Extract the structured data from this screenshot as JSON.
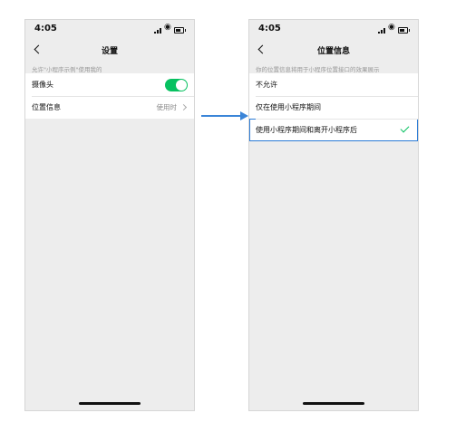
{
  "left_screen": {
    "time": "4:05",
    "title": "设置",
    "section_header": "允许\"小程序示例\"使用我的",
    "camera_label": "摄像头",
    "location_label": "位置信息",
    "location_value": "使用时"
  },
  "right_screen": {
    "time": "4:05",
    "title": "位置信息",
    "section_header": "你的位置信息将用于小程序位置接口的效果展示",
    "options": [
      {
        "label": "不允许"
      },
      {
        "label": "仅在使用小程序期间"
      },
      {
        "label": "使用小程序期间和离开小程序后"
      }
    ]
  },
  "colors": {
    "accent_green": "#07c160",
    "selection_blue": "#2b7bd6",
    "arrow_blue": "#3b85d8",
    "background_gray": "#ededed"
  },
  "icons": [
    "signal-icon",
    "wifi-icon",
    "battery-icon",
    "back-icon",
    "toggle-switch",
    "chevron-right-icon",
    "check-icon",
    "arrow-icon"
  ]
}
